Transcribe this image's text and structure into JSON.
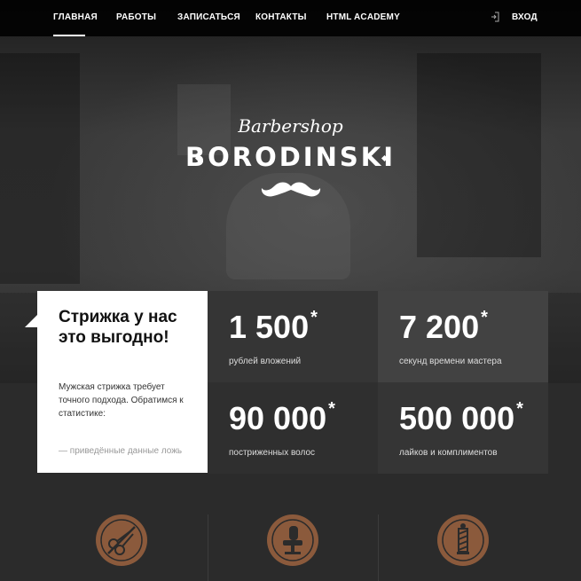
{
  "nav": {
    "items": [
      {
        "label": "ГЛАВНАЯ",
        "active": true
      },
      {
        "label": "РАБОТЫ"
      },
      {
        "label": "ЗАПИСАТЬСЯ"
      },
      {
        "label": "КОНТАКТЫ"
      },
      {
        "label": "HTML ACADEMY"
      }
    ],
    "login_label": "ВХОД"
  },
  "logo": {
    "script": "Barbershop",
    "main": "BORODINSKI"
  },
  "promo": {
    "title": "Стрижка у нас это выгодно!",
    "text": "Мужская стрижка требует точного подхода. Обратимся к статистике:",
    "footnote": "— приведённые данные ложь"
  },
  "stats": [
    {
      "value": "1 500",
      "mark": "*",
      "label": "рублей вложений"
    },
    {
      "value": "7 200",
      "mark": "*",
      "label": "секунд времени мастера"
    },
    {
      "value": "90 000",
      "mark": "*",
      "label": "постриженных волос"
    },
    {
      "value": "500 000",
      "mark": "*",
      "label": "лайков и комплиментов"
    }
  ],
  "colors": {
    "accent": "#8b5a3c",
    "nav_bg": "#000000",
    "card_bg": "#ffffff"
  },
  "icons": [
    "scissors-icon",
    "barber-chair-icon",
    "barber-pole-icon"
  ]
}
